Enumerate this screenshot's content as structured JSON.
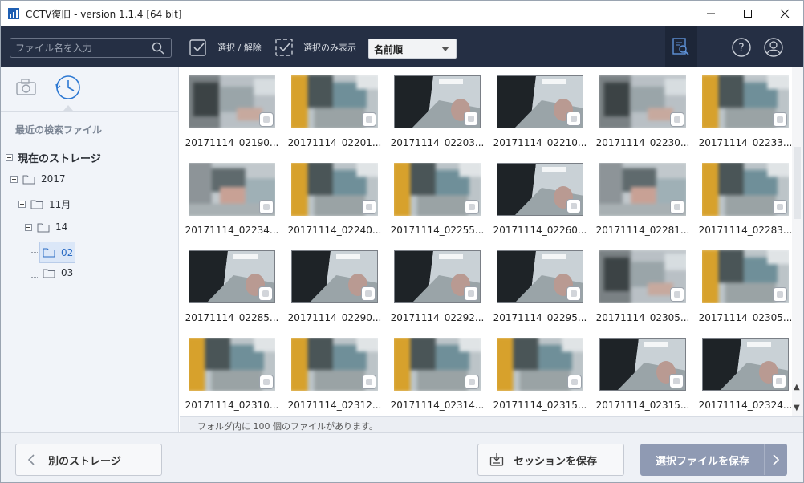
{
  "window": {
    "title": "CCTV復旧 - version 1.1.4 [64 bit]"
  },
  "toolbar": {
    "search_placeholder": "ファイル名を入力",
    "select_toggle_label": "選択 / 解除",
    "show_selected_label": "選択のみ表示",
    "sort_value": "名前順"
  },
  "sidebar": {
    "recent_label": "最近の検索ファイル",
    "tree": {
      "root": "現在のストレージ",
      "year": "2017",
      "month": "11月",
      "day": "14",
      "hour_selected": "02",
      "hour_other": "03"
    }
  },
  "files": [
    {
      "label": "20171114_02190...",
      "style": "pix-dark"
    },
    {
      "label": "20171114_02201...",
      "style": "pix-yellow"
    },
    {
      "label": "20171114_02203...",
      "style": "clear"
    },
    {
      "label": "20171114_02210...",
      "style": "clear"
    },
    {
      "label": "20171114_02230...",
      "style": "pix-dark"
    },
    {
      "label": "20171114_02233...",
      "style": "pix-yellow"
    },
    {
      "label": "20171114_02234...",
      "style": "pix-hall"
    },
    {
      "label": "20171114_02240...",
      "style": "pix-yellow"
    },
    {
      "label": "20171114_02255...",
      "style": "pix-yellow"
    },
    {
      "label": "20171114_02260...",
      "style": "clear"
    },
    {
      "label": "20171114_02281...",
      "style": "pix-hall"
    },
    {
      "label": "20171114_02283...",
      "style": "pix-yellow"
    },
    {
      "label": "20171114_02285...",
      "style": "clear"
    },
    {
      "label": "20171114_02290...",
      "style": "clear"
    },
    {
      "label": "20171114_02292...",
      "style": "clear"
    },
    {
      "label": "20171114_02295...",
      "style": "clear"
    },
    {
      "label": "20171114_02305...",
      "style": "pix-dark"
    },
    {
      "label": "20171114_02305...",
      "style": "pix-yellow"
    },
    {
      "label": "20171114_02310...",
      "style": "pix-yellow"
    },
    {
      "label": "20171114_02312...",
      "style": "pix-yellow"
    },
    {
      "label": "20171114_02314...",
      "style": "pix-yellow"
    },
    {
      "label": "20171114_02315...",
      "style": "pix-yellow"
    },
    {
      "label": "20171114_02315...",
      "style": "clear"
    },
    {
      "label": "20171114_02324...",
      "style": "clear"
    }
  ],
  "status_text": "フォルダ内に 100 個のファイルがあります。",
  "footer": {
    "back_label": "別のストレージ",
    "session_label": "セッションを保存",
    "save_label": "選択ファイルを保存"
  },
  "colors": {
    "toolbar_bg": "#252f44",
    "save_button": "#8f9ab3",
    "selected_folder": "#2b6cc4"
  }
}
